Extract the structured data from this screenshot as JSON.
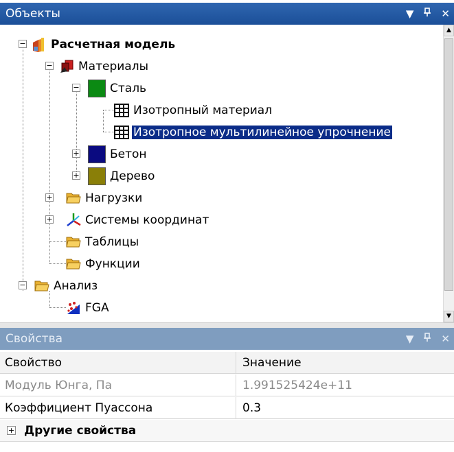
{
  "objects_panel": {
    "title": "Объекты",
    "buttons": {
      "dropdown": "▼",
      "pin": "ᵖ",
      "close": "✕"
    }
  },
  "tree": {
    "root": "Расчетная модель",
    "materials": "Материалы",
    "steel": "Сталь",
    "steel_children": [
      "Изотропный материал",
      "Изотропное мультилинейное упрочнение"
    ],
    "concrete": "Бетон",
    "wood": "Дерево",
    "loads": "Нагрузки",
    "coordinate_systems": "Системы координат",
    "tables": "Таблицы",
    "functions": "Функции",
    "analysis": "Анализ",
    "fga": "FGA",
    "selected_item": "Изотропное мультилинейное упрочнение"
  },
  "colors": {
    "steel": "#0b8a13",
    "concrete": "#0a0a80",
    "wood": "#8a7f08",
    "selection": "#0b2c88",
    "title_active": "#2459a6",
    "title_inactive": "#7f9dbf"
  },
  "properties_panel": {
    "title": "Свойства",
    "buttons": {
      "dropdown": "▼",
      "pin": "ᵖ",
      "close": "✕"
    },
    "columns": [
      "Свойство",
      "Значение"
    ],
    "rows": [
      {
        "name": "Модуль Юнга, Па",
        "value": "1.991525424e+11",
        "readonly": true
      },
      {
        "name": "Коэффициент Пуассона",
        "value": "0.3",
        "readonly": false
      }
    ],
    "group": "Другие свойства"
  }
}
